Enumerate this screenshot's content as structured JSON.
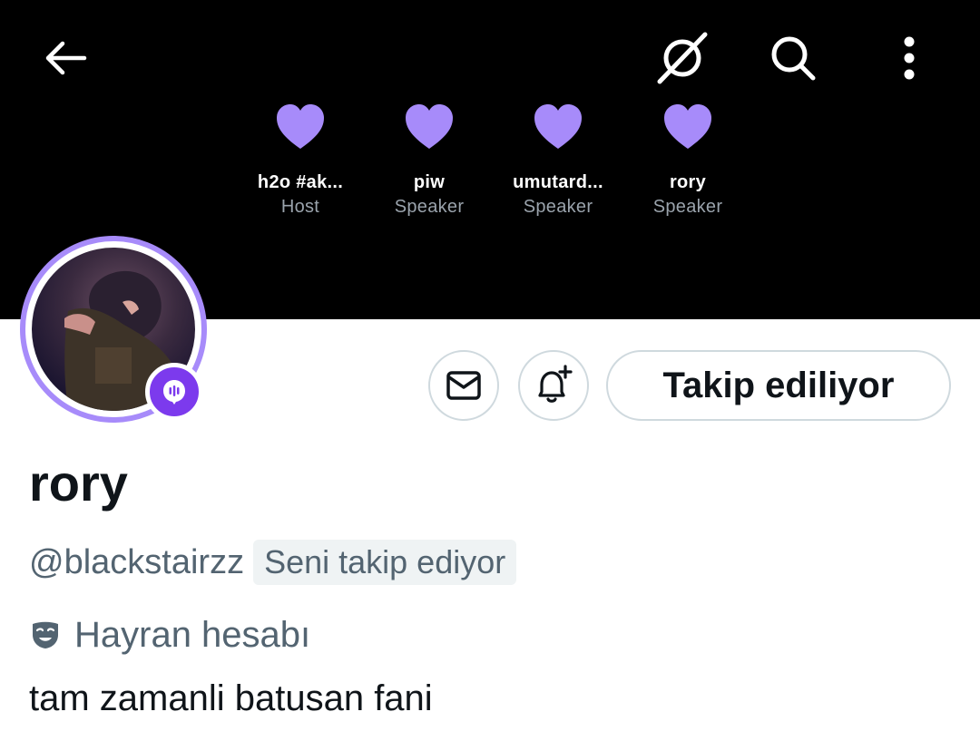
{
  "header": {
    "back_icon": "arrow-left-icon",
    "nospace_icon": "no-space-icon",
    "search_icon": "search-icon",
    "more_icon": "more-vertical-icon"
  },
  "space": {
    "participants": [
      {
        "name": "h2o #ak...",
        "role": "Host"
      },
      {
        "name": "piw",
        "role": "Speaker"
      },
      {
        "name": "umutard...",
        "role": "Speaker"
      },
      {
        "name": "rory",
        "role": "Speaker"
      }
    ],
    "heart_color": "#a78bfa"
  },
  "profile": {
    "display_name": "rory",
    "handle": "@blackstairzz",
    "follows_you": "Seni takip ediyor",
    "label": "Hayran hesabı",
    "bio": "tam zamanli batusan fani"
  },
  "actions": {
    "message_icon": "envelope-icon",
    "notify_icon": "bell-plus-icon",
    "follow_label": "Takip ediliyor"
  },
  "colors": {
    "accent": "#7c3aed",
    "avatar_ring": "#a78bfa",
    "muted_text": "#536471"
  }
}
